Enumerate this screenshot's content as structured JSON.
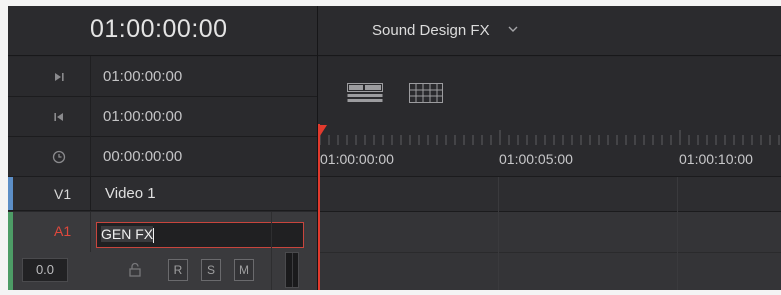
{
  "header": {
    "main_timecode": "01:00:00:00",
    "timeline_name": "Sound Design FX",
    "timeline_dropdown_icon": "chevron-down-icon"
  },
  "timecode_rows": [
    {
      "icon": "mark-in-icon",
      "value": "01:00:00:00"
    },
    {
      "icon": "mark-out-icon",
      "value": "01:00:00:00"
    },
    {
      "icon": "clock-icon",
      "value": "00:00:00:00"
    }
  ],
  "view_buttons": [
    {
      "icon": "track-height-view-icon"
    },
    {
      "icon": "grid-view-icon"
    }
  ],
  "ruler": {
    "labels": [
      "01:00:00:00",
      "01:00:05:00",
      "01:00:10:00"
    ]
  },
  "tracks": {
    "v1": {
      "code": "V1",
      "name": "Video 1",
      "color": "#5c8ec6"
    },
    "a1": {
      "code": "A1",
      "name_value": "GEN FX",
      "color": "#4d9c66",
      "volume": "0.0",
      "buttons": {
        "record": "R",
        "solo": "S",
        "mute": "M"
      }
    }
  },
  "colors": {
    "playhead": "#e23a2d",
    "selected_track_code": "#e0483d",
    "background": "#28282b"
  }
}
